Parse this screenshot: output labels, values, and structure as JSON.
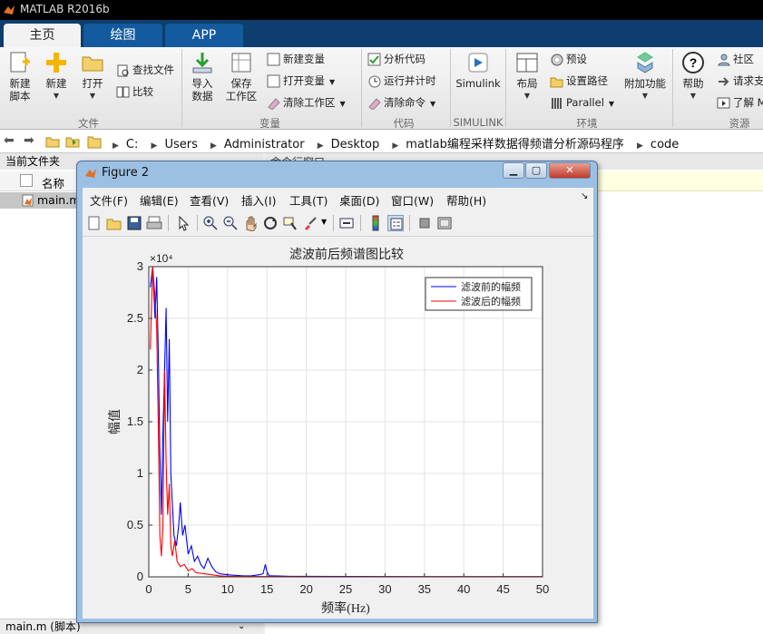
{
  "window": {
    "title": "MATLAB R2016b"
  },
  "tabs": [
    "主页",
    "绘图",
    "APP"
  ],
  "ribbon": {
    "file": {
      "new_script": "新建\n脚本",
      "new": "新建",
      "open": "打开",
      "find_files": "查找文件",
      "compare": "比较",
      "section": "文件"
    },
    "variable": {
      "import": "导入\n数据",
      "save_ws": "保存\n工作区",
      "new_var": "新建变量",
      "open_var": "打开变量",
      "clear_ws": "清除工作区",
      "section": "变量"
    },
    "code": {
      "analyze": "分析代码",
      "run_time": "运行并计时",
      "clear_cmd": "清除命令",
      "section": "代码"
    },
    "simulink": {
      "label": "Simulink",
      "section": "SIMULINK"
    },
    "env": {
      "layout": "布局",
      "prefs": "预设",
      "set_path": "设置路径",
      "parallel": "Parallel",
      "addons": "附加功能",
      "section": "环境"
    },
    "resources": {
      "help": "帮助",
      "community": "社区",
      "request": "请求支",
      "learn": "了解 M",
      "section": "资源"
    }
  },
  "address": {
    "parts": [
      "C:",
      "Users",
      "Administrator",
      "Desktop",
      "matlab编程采样数据得频谱分析源码程序",
      "code"
    ]
  },
  "left_panel": {
    "title": "当前文件夹",
    "col_name": "名称",
    "file": "main.m",
    "status": "main.m  (脚本)"
  },
  "right_panel": {
    "title": "命令行窗口"
  },
  "figure": {
    "title": "Figure 2",
    "menu": [
      "文件(F)",
      "编辑(E)",
      "查看(V)",
      "插入(I)",
      "工具(T)",
      "桌面(D)",
      "窗口(W)",
      "帮助(H)"
    ]
  },
  "chart_data": {
    "type": "line",
    "title": "滤波前后频谱图比较",
    "xlabel": "频率(Hz)",
    "ylabel": "幅值",
    "exponent_label": "×10⁴",
    "xlim": [
      0,
      50
    ],
    "ylim": [
      0,
      3
    ],
    "xticks": [
      "0",
      "5",
      "10",
      "15",
      "20",
      "25",
      "30",
      "35",
      "40",
      "45",
      "50"
    ],
    "yticks": [
      "0",
      "0.5",
      "1",
      "1.5",
      "2",
      "2.5",
      "3"
    ],
    "grid": true,
    "legend_position": "top-right",
    "series": [
      {
        "name": "滤波前的幅频",
        "color": "#0000ff",
        "x": [
          0.2,
          0.5,
          0.8,
          1.0,
          1.2,
          1.4,
          1.6,
          1.8,
          2.0,
          2.2,
          2.4,
          2.6,
          2.8,
          3.0,
          3.2,
          3.5,
          3.8,
          4.0,
          4.3,
          4.6,
          5.0,
          5.4,
          5.8,
          6.2,
          6.6,
          7.0,
          7.5,
          8.0,
          8.5,
          9,
          10,
          11,
          12,
          13,
          14,
          14.5,
          14.8,
          15.0,
          15.3,
          16,
          18,
          20,
          25,
          30,
          35,
          40,
          45,
          50
        ],
        "y": [
          2.8,
          3.0,
          2.5,
          2.9,
          2.2,
          1.2,
          0.6,
          1.4,
          2.0,
          2.6,
          1.5,
          2.3,
          1.0,
          0.7,
          0.4,
          0.3,
          0.5,
          0.72,
          0.4,
          0.5,
          0.22,
          0.3,
          0.15,
          0.2,
          0.12,
          0.08,
          0.18,
          0.1,
          0.05,
          0.03,
          0.02,
          0.015,
          0.01,
          0.01,
          0.02,
          0.03,
          0.12,
          0.05,
          0.01,
          0.01,
          0.005,
          0.005,
          0.004,
          0.003,
          0.002,
          0.002,
          0.002,
          0.002
        ]
      },
      {
        "name": "滤波后的幅频",
        "color": "#ff0000",
        "x": [
          0.2,
          0.5,
          0.8,
          1.0,
          1.2,
          1.4,
          1.6,
          1.8,
          2.0,
          2.2,
          2.4,
          2.6,
          2.8,
          3.0,
          3.3,
          3.6,
          4.0,
          4.5,
          5.0,
          5.5,
          6.0,
          7.0,
          8.0,
          9.0,
          10,
          12,
          15,
          20,
          25,
          30,
          35,
          40,
          45,
          50
        ],
        "y": [
          2.2,
          3.0,
          2.7,
          2.4,
          1.5,
          0.4,
          0.2,
          0.5,
          2.0,
          1.1,
          0.6,
          0.9,
          0.3,
          0.2,
          0.35,
          0.15,
          0.1,
          0.12,
          0.06,
          0.08,
          0.04,
          0.03,
          0.02,
          0.01,
          0.005,
          0.004,
          0.003,
          0.002,
          0.002,
          0.002,
          0.002,
          0.002,
          0.002,
          0.002
        ]
      }
    ]
  },
  "colors": {
    "ribbon_tab_bg": "#0d3e6e",
    "title_bar": "#000000",
    "figure_frame": "#9cc0e2"
  }
}
